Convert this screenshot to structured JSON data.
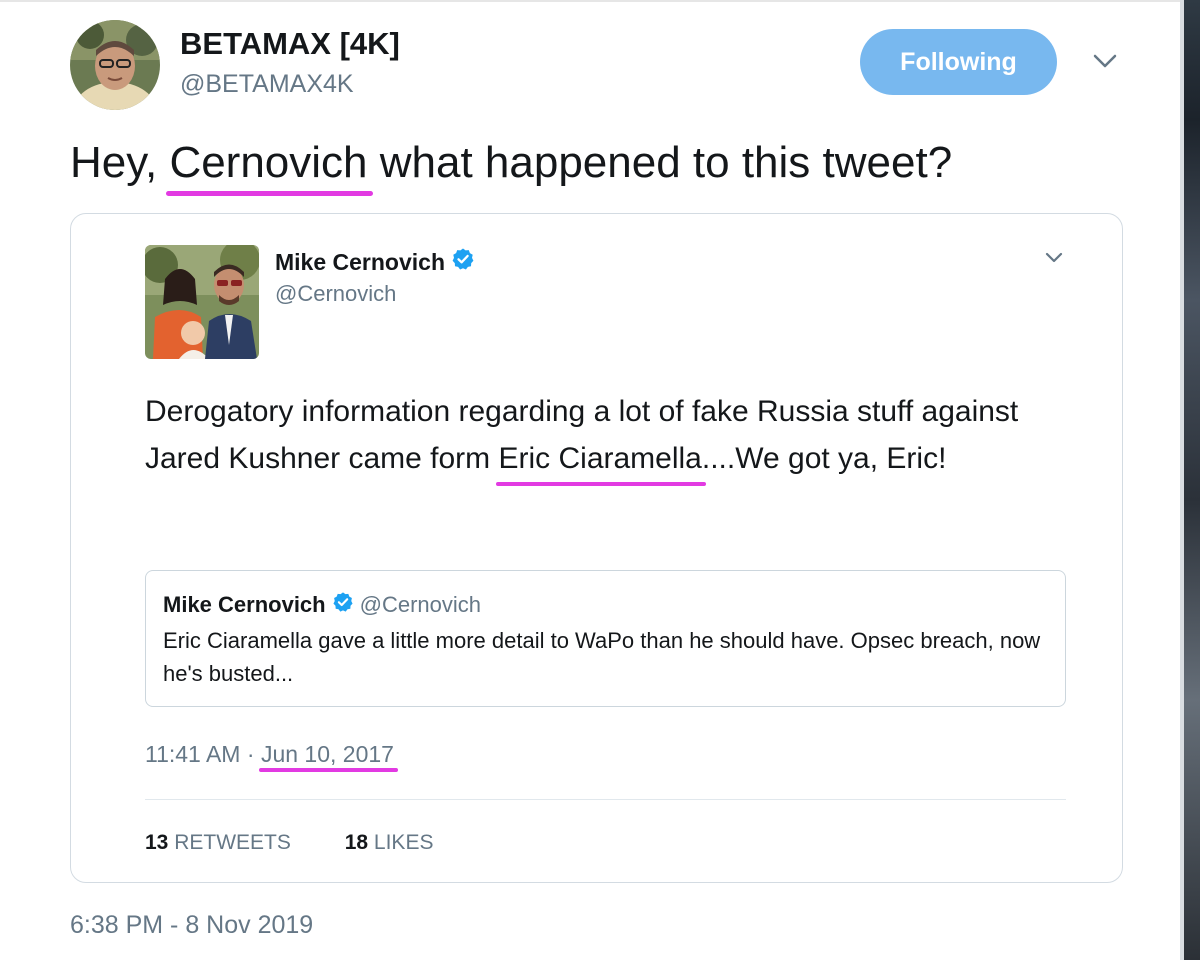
{
  "tweet": {
    "author": {
      "display_name": "BETAMAX [4K]",
      "handle": "@BETAMAX4K"
    },
    "follow_button_label": "Following",
    "text": {
      "before": "Hey, ",
      "highlight": "Cernovich",
      "after": " what happened to this tweet?"
    },
    "timestamp": "6:38 PM - 8 Nov 2019"
  },
  "quoted_tweet": {
    "author": {
      "display_name": "Mike Cernovich",
      "handle": "@Cernovich",
      "verified": true
    },
    "text": {
      "part1": "Derogatory information regarding a lot of fake Russia stuff against Jared Kushner came form ",
      "highlight": "Eric Ciaramella",
      "part2": "....We got ya, Eric!"
    },
    "inner_quote": {
      "display_name": "Mike Cernovich",
      "handle": "@Cernovich",
      "text": "Eric Ciaramella gave a little more detail to WaPo than he should have. Opsec breach, now he's busted..."
    },
    "time": "11:41 AM",
    "separator": " · ",
    "date": "Jun 10, 2017",
    "stats": {
      "retweets_count": "13",
      "retweets_label": "RETWEETS",
      "likes_count": "18",
      "likes_label": "LIKES"
    }
  },
  "colors": {
    "highlight_underline": "#e23ae2",
    "follow_button": "#78b8ef",
    "verified": "#1da1f2",
    "secondary_text": "#657786"
  }
}
